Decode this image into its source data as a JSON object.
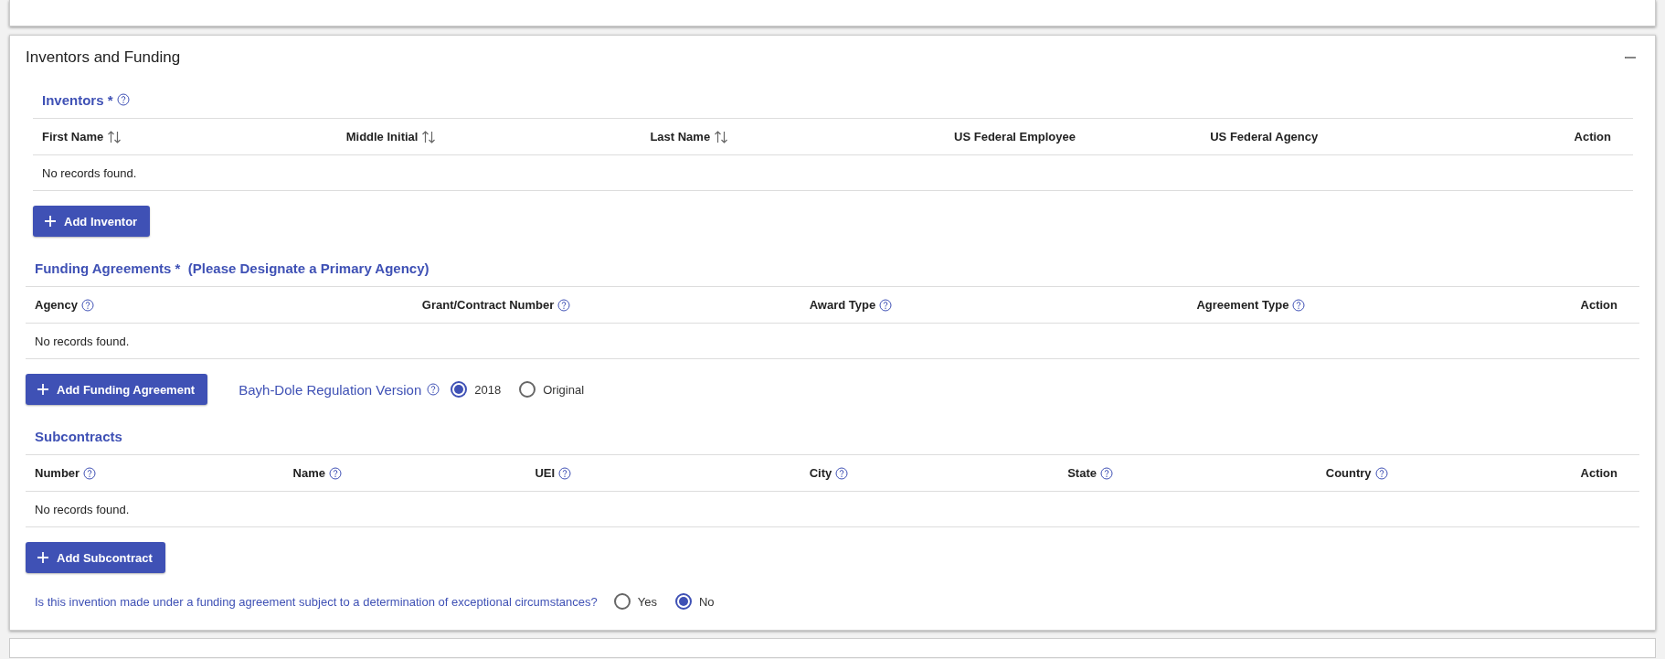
{
  "panel": {
    "title": "Inventors and Funding",
    "expanded": true
  },
  "inventors": {
    "heading": "Inventors *",
    "columns": [
      {
        "label": "First Name",
        "kind": "sortable"
      },
      {
        "label": "Middle Initial",
        "kind": "sortable"
      },
      {
        "label": "Last Name",
        "kind": "sortable"
      },
      {
        "label": "US Federal Employee",
        "kind": "plain"
      },
      {
        "label": "US Federal Agency",
        "kind": "plain"
      },
      {
        "label": "Action",
        "kind": "action"
      }
    ],
    "empty": "No records found.",
    "button": "Add Inventor"
  },
  "funding": {
    "heading": "Funding Agreements *  (Please Designate a Primary Agency)",
    "columns": [
      {
        "label": "Agency",
        "kind": "help"
      },
      {
        "label": "Grant/Contract Number",
        "kind": "help"
      },
      {
        "label": "Award Type",
        "kind": "help"
      },
      {
        "label": "Agreement Type",
        "kind": "help"
      },
      {
        "label": "Action",
        "kind": "action"
      }
    ],
    "empty": "No records found.",
    "button": "Add Funding Agreement",
    "regulation": {
      "label": "Bayh-Dole Regulation Version",
      "options": [
        {
          "label": "2018",
          "selected": true
        },
        {
          "label": "Original",
          "selected": false
        }
      ]
    }
  },
  "subcontracts": {
    "heading": "Subcontracts",
    "columns": [
      {
        "label": "Number",
        "kind": "help"
      },
      {
        "label": "Name",
        "kind": "help"
      },
      {
        "label": "UEI",
        "kind": "help"
      },
      {
        "label": "City",
        "kind": "help"
      },
      {
        "label": "State",
        "kind": "help"
      },
      {
        "label": "Country",
        "kind": "help"
      },
      {
        "label": "Action",
        "kind": "action"
      }
    ],
    "empty": "No records found.",
    "button": "Add Subcontract"
  },
  "exceptional": {
    "question": "Is this invention made under a funding agreement subject to a determination of exceptional circumstances?",
    "options": [
      {
        "label": "Yes",
        "selected": false
      },
      {
        "label": "No",
        "selected": true
      }
    ]
  }
}
